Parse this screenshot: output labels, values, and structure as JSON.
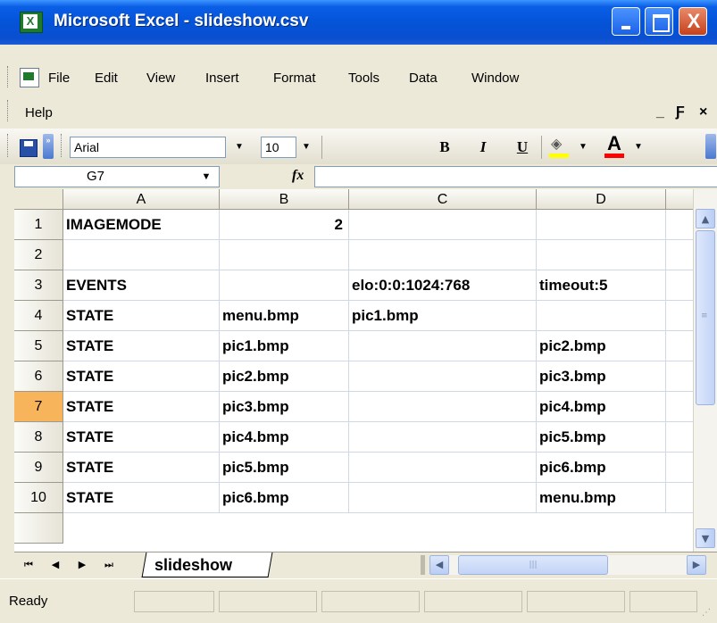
{
  "window": {
    "title": "Microsoft Excel - slideshow.csv",
    "app_icon": "excel-icon",
    "minimize_icon": "minimize-icon",
    "maximize_icon": "maximize-icon",
    "close_glyph": "X"
  },
  "menu": {
    "items": [
      "File",
      "Edit",
      "View",
      "Insert",
      "Format",
      "Tools",
      "Data",
      "Window"
    ],
    "help": "Help",
    "mdi_min": "_",
    "mdi_restore": "Ƒ",
    "mdi_close": "×"
  },
  "toolbar": {
    "font_name": "Arial",
    "font_size": "10",
    "bold": "B",
    "italic": "I",
    "underline": "U",
    "fill_color": "#ffff00",
    "font_color": "#ff0000",
    "font_color_glyph": "A"
  },
  "formula_bar": {
    "name_box": "G7",
    "fx": "fx",
    "formula": ""
  },
  "grid": {
    "columns": [
      "A",
      "B",
      "C",
      "D"
    ],
    "rows": [
      {
        "num": "1",
        "cells": [
          "IMAGEMODE",
          "2",
          "",
          ""
        ]
      },
      {
        "num": "2",
        "cells": [
          "",
          "",
          "",
          ""
        ]
      },
      {
        "num": "3",
        "cells": [
          "EVENTS",
          "",
          "elo:0:0:1024:768",
          "timeout:5"
        ]
      },
      {
        "num": "4",
        "cells": [
          "STATE",
          "menu.bmp",
          "pic1.bmp",
          ""
        ]
      },
      {
        "num": "5",
        "cells": [
          "STATE",
          "pic1.bmp",
          "",
          "pic2.bmp"
        ]
      },
      {
        "num": "6",
        "cells": [
          "STATE",
          "pic2.bmp",
          "",
          "pic3.bmp"
        ]
      },
      {
        "num": "7",
        "cells": [
          "STATE",
          "pic3.bmp",
          "",
          "pic4.bmp"
        ]
      },
      {
        "num": "8",
        "cells": [
          "STATE",
          "pic4.bmp",
          "",
          "pic5.bmp"
        ]
      },
      {
        "num": "9",
        "cells": [
          "STATE",
          "pic5.bmp",
          "",
          "pic6.bmp"
        ]
      },
      {
        "num": "10",
        "cells": [
          "STATE",
          "pic6.bmp",
          "",
          "menu.bmp"
        ]
      }
    ],
    "active_row": "7",
    "active_row_color": "#f8b45a"
  },
  "sheet_tabs": {
    "active": "slideshow"
  },
  "status": {
    "text": "Ready"
  }
}
